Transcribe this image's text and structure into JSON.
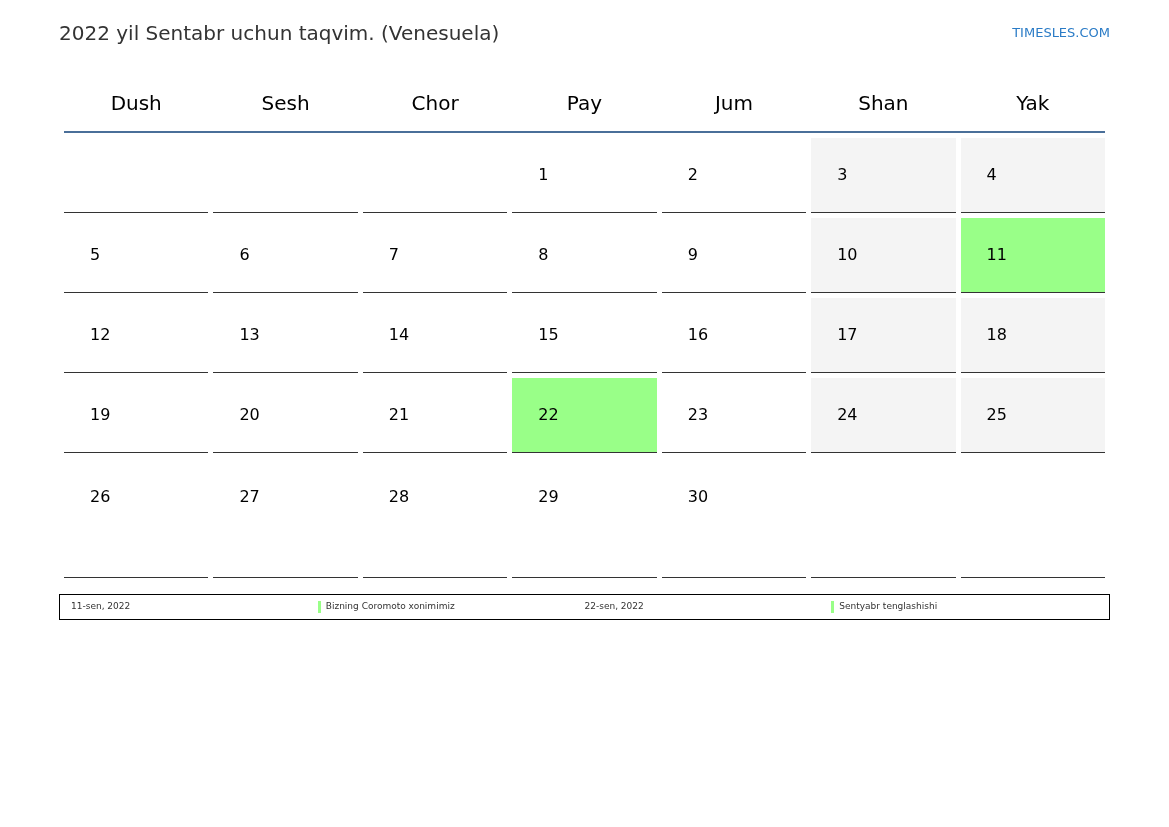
{
  "title": "2022 yil Sentabr uchun taqvim. (Venesuela)",
  "site": "TIMESLES.COM",
  "weekdays": [
    "Dush",
    "Sesh",
    "Chor",
    "Pay",
    "Jum",
    "Shan",
    "Yak"
  ],
  "weeks": [
    [
      {
        "kind": "blank"
      },
      {
        "kind": "blank"
      },
      {
        "kind": "blank"
      },
      {
        "kind": "weekday",
        "day": "1"
      },
      {
        "kind": "weekday",
        "day": "2"
      },
      {
        "kind": "weekend",
        "day": "3"
      },
      {
        "kind": "weekend",
        "day": "4"
      }
    ],
    [
      {
        "kind": "weekday",
        "day": "5"
      },
      {
        "kind": "weekday",
        "day": "6"
      },
      {
        "kind": "weekday",
        "day": "7"
      },
      {
        "kind": "weekday",
        "day": "8"
      },
      {
        "kind": "weekday",
        "day": "9"
      },
      {
        "kind": "weekend",
        "day": "10"
      },
      {
        "kind": "holiday",
        "day": "11"
      }
    ],
    [
      {
        "kind": "weekday",
        "day": "12"
      },
      {
        "kind": "weekday",
        "day": "13"
      },
      {
        "kind": "weekday",
        "day": "14"
      },
      {
        "kind": "weekday",
        "day": "15"
      },
      {
        "kind": "weekday",
        "day": "16"
      },
      {
        "kind": "weekend",
        "day": "17"
      },
      {
        "kind": "weekend",
        "day": "18"
      }
    ],
    [
      {
        "kind": "weekday",
        "day": "19"
      },
      {
        "kind": "weekday",
        "day": "20"
      },
      {
        "kind": "weekday",
        "day": "21"
      },
      {
        "kind": "holiday",
        "day": "22"
      },
      {
        "kind": "weekday",
        "day": "23"
      },
      {
        "kind": "weekend",
        "day": "24"
      },
      {
        "kind": "weekend",
        "day": "25"
      }
    ],
    [
      {
        "kind": "weekday",
        "day": "26"
      },
      {
        "kind": "weekday",
        "day": "27"
      },
      {
        "kind": "weekday",
        "day": "28"
      },
      {
        "kind": "weekday",
        "day": "29"
      },
      {
        "kind": "weekday",
        "day": "30"
      },
      {
        "kind": "blank"
      },
      {
        "kind": "blank"
      }
    ]
  ],
  "holidays": [
    {
      "date": "11-sen, 2022",
      "name": "Bizning Coromoto xonimimiz",
      "color": "#99ff88"
    },
    {
      "date": "22-sen, 2022",
      "name": "Sentyabr tenglashishi",
      "color": "#99ff88"
    }
  ]
}
